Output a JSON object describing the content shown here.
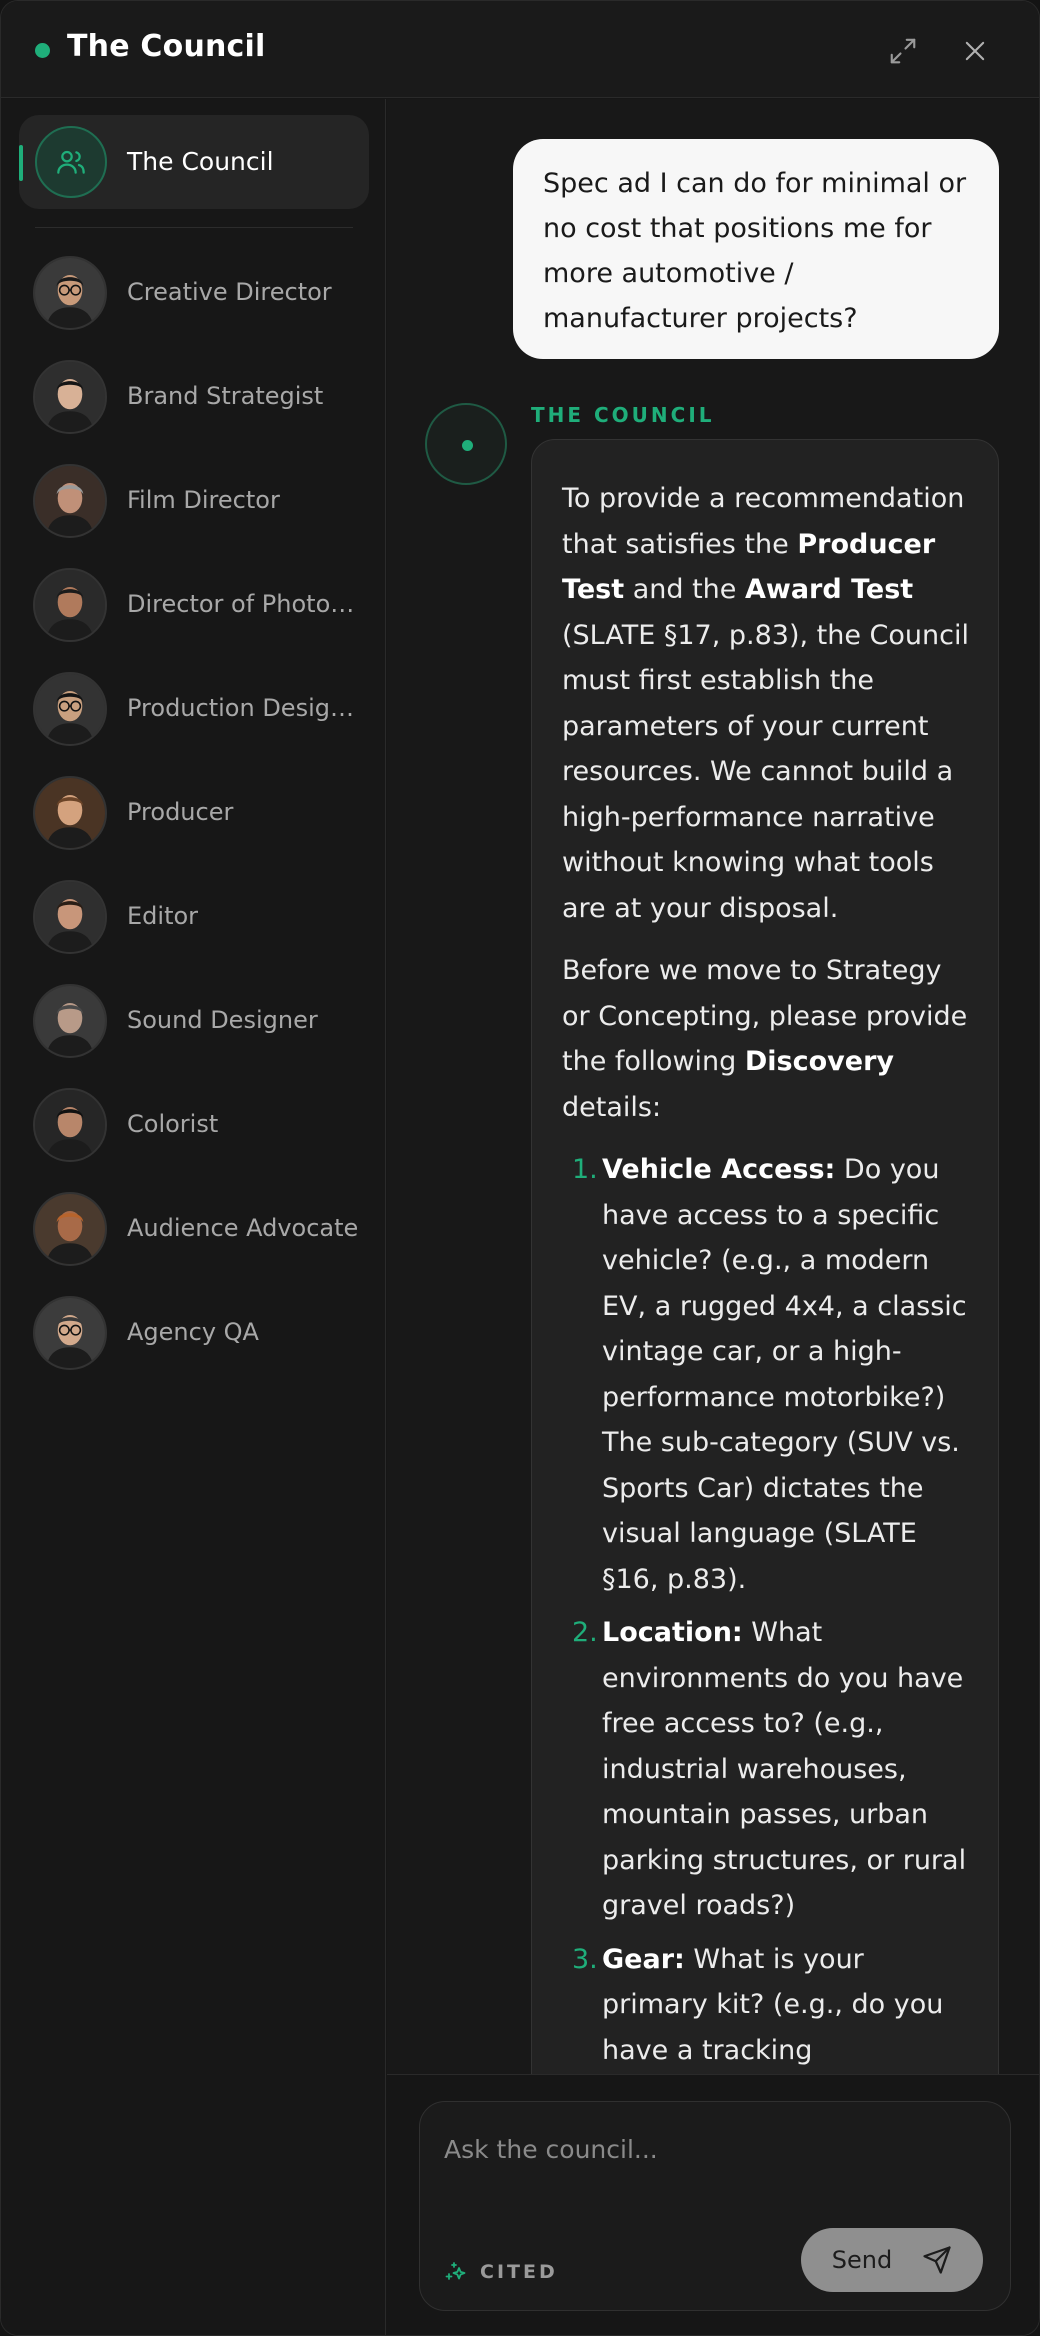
{
  "header": {
    "title": "The Council"
  },
  "sidebar": {
    "active": {
      "label": "The Council"
    },
    "members": [
      {
        "label": "Creative Director",
        "skin": "#c89a7a",
        "hair": "#1a1a1a",
        "bg": "#3a3a3a",
        "glasses": true
      },
      {
        "label": "Brand Strategist",
        "skin": "#d8b196",
        "hair": "#151515",
        "bg": "#2e2e2e",
        "glasses": false
      },
      {
        "label": "Film Director",
        "skin": "#c09078",
        "hair": "#9a9a9a",
        "bg": "#3a2e28",
        "glasses": false
      },
      {
        "label": "Director of Photography",
        "skin": "#b07a5c",
        "hair": "#1b1b1b",
        "bg": "#2a2a2a",
        "glasses": false
      },
      {
        "label": "Production Designer",
        "skin": "#c9a07f",
        "hair": "#141414",
        "bg": "#333333",
        "glasses": true
      },
      {
        "label": "Producer",
        "skin": "#d4a27e",
        "hair": "#6b4428",
        "bg": "#4a3424",
        "glasses": false
      },
      {
        "label": "Editor",
        "skin": "#c8967a",
        "hair": "#2a1e16",
        "bg": "#2f2f2f",
        "glasses": false
      },
      {
        "label": "Sound Designer",
        "skin": "#b89a88",
        "hair": "#4a4a4a",
        "bg": "#3a3a3a",
        "glasses": false
      },
      {
        "label": "Colorist",
        "skin": "#b8866a",
        "hair": "#111111",
        "bg": "#262626",
        "glasses": false
      },
      {
        "label": "Audience Advocate",
        "skin": "#a86a48",
        "hair": "#b8642c",
        "bg": "#4a3a2e",
        "glasses": false
      },
      {
        "label": "Agency QA",
        "skin": "#d2a98c",
        "hair": "#3a3a3a",
        "bg": "#3c3c3c",
        "glasses": true
      }
    ]
  },
  "chat": {
    "user_message": "Spec ad I can do for minimal or no cost that positions me for more automotive / manufacturer projects?",
    "assistant_name": "THE COUNCIL",
    "response": {
      "p1_a": "To provide a recommendation that satisfies the ",
      "p1_b": "Producer Test",
      "p1_c": " and the ",
      "p1_d": "Award Test",
      "p1_e": " (SLATE §17, p.83), the Council must first establish the parameters of your current resources. We cannot build a high-performance narrative without knowing what tools are at your disposal.",
      "p2_a": "Before we move to Strategy or Concepting, please provide the following ",
      "p2_b": "Discovery",
      "p2_c": " details:",
      "items": [
        {
          "num": "1.",
          "title": "Vehicle Access:",
          "text": " Do you have access to a specific vehicle? (e.g., a modern EV, a rugged 4x4, a classic vintage car, or a high-performance motorbike?) The sub-category (SUV vs. Sports Car) dictates the visual language (SLATE §16, p.83)."
        },
        {
          "num": "2.",
          "title": "Location:",
          "text": " What environments do you have free access to? (e.g., industrial warehouses, mountain passes, urban parking structures, or rural gravel roads?)"
        },
        {
          "num": "3.",
          "title": "Gear:",
          "text": " What is your primary kit? (e.g., do you have a tracking vehicle/gimbal, a drone, or are we reliant on"
        }
      ]
    }
  },
  "composer": {
    "placeholder": "Ask the council...",
    "cited_label": "CITED",
    "send_label": "Send"
  },
  "colors": {
    "accent": "#1fae7a",
    "background": "#161616",
    "user_bubble": "#f7f7f7"
  }
}
